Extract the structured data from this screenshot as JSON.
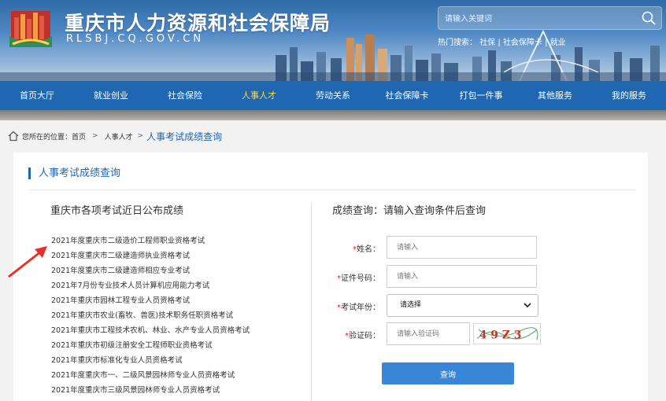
{
  "header": {
    "title": "重庆市人力资源和社会保障局",
    "subtitle": "RLSBJ.CQ.GOV.CN",
    "search_placeholder": "请输入关键词",
    "hot_label": "热门搜索：",
    "hot_words": [
      "社保",
      "社会保障卡",
      "就业"
    ]
  },
  "nav": {
    "items": [
      "首页大厅",
      "就业创业",
      "社会保险",
      "人事人才",
      "劳动关系",
      "社会保障卡",
      "打包一件事",
      "其他服务",
      "我的服务"
    ],
    "active": "人事人才"
  },
  "breadcrumb": {
    "prefix": "您所在的位置：",
    "home": "首页",
    "sep": ">",
    "level1": "人事人才",
    "current": "人事考试成绩查询"
  },
  "section_title": "人事考试成绩查询",
  "left": {
    "title": "重庆市各项考试近日公布成绩",
    "exams": [
      "2021年度重庆市二级造价工程师职业资格考试",
      "2021年度重庆市二级建造师执业资格考试",
      "2021年度重庆市二级建造师相应专业考试",
      "2021年7月份专业技术人员计算机应用能力考试",
      "2021年重庆市园林工程专业人员资格考试",
      "2021年重庆市农业(畜牧、兽医)技术职务任职资格考试",
      "2021年重庆市工程技术农机、林业、水产专业人员资格考试",
      "2021年重庆市初级注册安全工程师职业资格考试",
      "2021年重庆市标准化专业人员资格考试",
      "2021年度重庆市一、二级风景园林师专业人员资格考试",
      "2021年度重庆市三级风景园林师专业人员资格考试"
    ]
  },
  "right": {
    "title": "成绩查询：请输入查询条件后查询",
    "required_mark": "*",
    "name_label": "姓名：",
    "name_placeholder": "请输入",
    "id_label": "证件号码：",
    "id_placeholder": "请输入",
    "year_label": "考试年份：",
    "year_value": "请选择",
    "captcha_label": "验证码：",
    "captcha_placeholder": "请输入验证码",
    "captcha_text": "4 9 Z 3",
    "submit_label": "查询"
  },
  "colors": {
    "nav_bg": "#1f67b1",
    "nav_active": "#ffd94a",
    "accent": "#1f67b1",
    "button": "#3a86d6",
    "arrow": "#e8302a",
    "required": "#e02020"
  }
}
